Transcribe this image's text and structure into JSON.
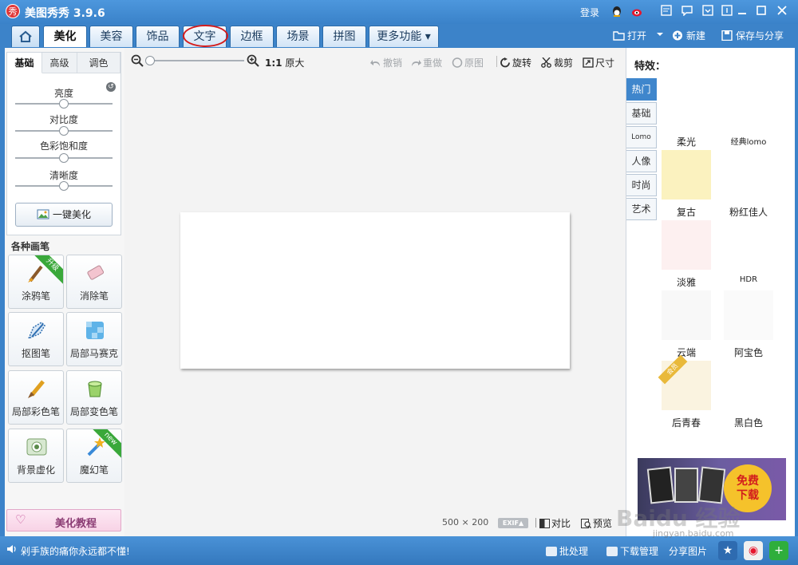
{
  "app": {
    "logo_char": "秀",
    "title": "美图秀秀 3.9.6"
  },
  "titlebar": {
    "login": "登录"
  },
  "tabs": [
    {
      "label": "美化",
      "active": true
    },
    {
      "label": "美容",
      "active": false
    },
    {
      "label": "饰品",
      "active": false
    },
    {
      "label": "文字",
      "active": false,
      "highlighted": true
    },
    {
      "label": "边框",
      "active": false
    },
    {
      "label": "场景",
      "active": false
    },
    {
      "label": "拼图",
      "active": false
    }
  ],
  "more_tab": {
    "label": "更多功能 ▾"
  },
  "top_actions": {
    "open": "打开",
    "new": "新建",
    "save_share": "保存与分享"
  },
  "left_panel": {
    "subtabs": [
      {
        "label": "基础",
        "active": true
      },
      {
        "label": "高级",
        "active": false
      },
      {
        "label": "调色",
        "active": false
      }
    ],
    "sliders": [
      {
        "label": "亮度",
        "value": 0.5
      },
      {
        "label": "对比度",
        "value": 0.5
      },
      {
        "label": "色彩饱和度",
        "value": 0.5
      },
      {
        "label": "清晰度",
        "value": 0.5
      }
    ],
    "one_key": "一键美化",
    "brush_section_title": "各种画笔",
    "brushes": [
      {
        "label": "涂鸦笔",
        "badge": "升级",
        "icon": "paintbrush-icon"
      },
      {
        "label": "消除笔",
        "badge": "",
        "icon": "eraser-icon"
      },
      {
        "label": "抠图笔",
        "badge": "",
        "icon": "cutout-pen-icon"
      },
      {
        "label": "局部马赛克",
        "badge": "",
        "icon": "mosaic-icon"
      },
      {
        "label": "局部彩色笔",
        "badge": "",
        "icon": "color-brush-icon"
      },
      {
        "label": "局部变色笔",
        "badge": "",
        "icon": "paint-bucket-icon"
      },
      {
        "label": "背景虚化",
        "badge": "",
        "icon": "blur-icon"
      },
      {
        "label": "魔幻笔",
        "badge": "new",
        "icon": "magic-wand-icon"
      }
    ],
    "tutorial": "美化教程"
  },
  "canvas_toolbar": {
    "ratio_bold": "1:1",
    "ratio_label": "原大",
    "undo": "撤销",
    "redo": "重做",
    "original": "原图",
    "rotate": "旋转",
    "crop": "裁剪",
    "size": "尺寸"
  },
  "canvas_footer": {
    "dimensions": "500 × 200",
    "exif": "EXIF▲",
    "compare": "对比",
    "preview": "预览"
  },
  "right_panel": {
    "title": "特效：",
    "categories": [
      {
        "label": "热门",
        "active": true
      },
      {
        "label": "基础",
        "active": false
      },
      {
        "label": "Lomo",
        "active": false
      },
      {
        "label": "人像",
        "active": false
      },
      {
        "label": "时尚",
        "active": false
      },
      {
        "label": "艺术",
        "active": false
      }
    ],
    "effects": [
      {
        "label": "柔光",
        "color": "#ffffff"
      },
      {
        "label": "经典lomo",
        "color": "#ffffff"
      },
      {
        "label": "复古",
        "color": "#fbf2bf"
      },
      {
        "label": "粉红佳人",
        "color": "#ffffff"
      },
      {
        "label": "淡雅",
        "color": "#fdf0f0"
      },
      {
        "label": "HDR",
        "color": "#ffffff"
      },
      {
        "label": "云端",
        "color": "#f8f8f8"
      },
      {
        "label": "阿宝色",
        "color": "#fafafa"
      },
      {
        "label": "后青春",
        "color": "#faf3e0",
        "badge": "会员"
      },
      {
        "label": "黑白色",
        "color": "#ffffff"
      }
    ],
    "ad": {
      "line1": "免费",
      "line2": "下载"
    }
  },
  "statusbar": {
    "text": "剁手族的痛你永远都不懂!",
    "batch": "批处理",
    "download": "下载管理",
    "share": "分享图片"
  },
  "watermark": {
    "brand": "Baidu 经验",
    "url": "jingyan.baidu.com"
  },
  "colors": {
    "title_blue": "#3c83c9",
    "active_category": "#3f86cc",
    "highlight_circle": "#d41c1c"
  }
}
